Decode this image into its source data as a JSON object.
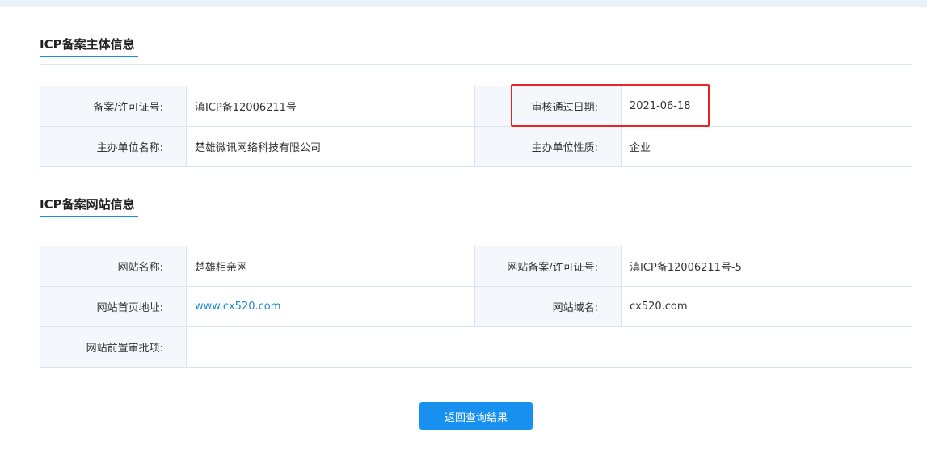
{
  "subject_section": {
    "title": "ICP备案主体信息",
    "rows": [
      [
        {
          "label": "备案/许可证号:",
          "value": "滇ICP备12006211号"
        },
        {
          "label": "审核通过日期:",
          "value": "2021-06-18"
        }
      ],
      [
        {
          "label": "主办单位名称:",
          "value": "楚雄微讯网络科技有限公司"
        },
        {
          "label": "主办单位性质:",
          "value": "企业"
        }
      ]
    ]
  },
  "website_section": {
    "title": "ICP备案网站信息",
    "rows": [
      [
        {
          "label": "网站名称:",
          "value": "楚雄相亲网"
        },
        {
          "label": "网站备案/许可证号:",
          "value": "滇ICP备12006211号-5"
        }
      ],
      [
        {
          "label": "网站首页地址:",
          "value": "www.cx520.com"
        },
        {
          "label": "网站域名:",
          "value": "cx520.com"
        }
      ],
      [
        {
          "label": "网站前置审批项:",
          "value": ""
        }
      ]
    ]
  },
  "actions": {
    "back_label": "返回查询结果"
  },
  "colors": {
    "accent": "#1890f0",
    "link": "#1a85d6",
    "highlight": "#e8251f",
    "label_bg": "#f4f8fc"
  }
}
